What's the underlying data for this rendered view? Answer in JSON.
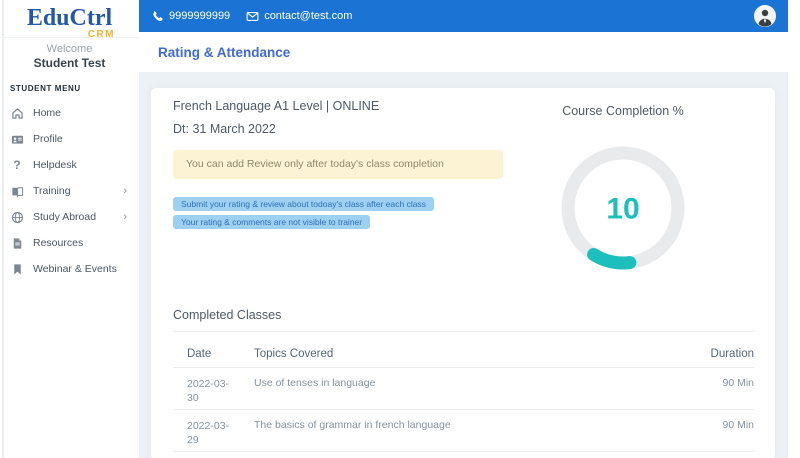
{
  "ui": {
    "chevron": "›",
    "question_glyph": "?"
  },
  "topbar": {
    "phone": "9999999999",
    "email": "contact@test.com"
  },
  "sidebar": {
    "logo": "EduCtrl",
    "logo_sub": "CRM",
    "welcome": "Welcome",
    "user_name": "Student Test",
    "menu_label": "STUDENT MENU",
    "items": [
      {
        "label": "Home",
        "icon": "home-icon",
        "has_submenu": false
      },
      {
        "label": "Profile",
        "icon": "profile-icon",
        "has_submenu": false
      },
      {
        "label": "Helpdesk",
        "icon": "helpdesk-icon",
        "has_submenu": false
      },
      {
        "label": "Training",
        "icon": "training-icon",
        "has_submenu": true
      },
      {
        "label": "Study Abroad",
        "icon": "globe-icon",
        "has_submenu": true
      },
      {
        "label": "Resources",
        "icon": "resources-icon",
        "has_submenu": false
      },
      {
        "label": "Webinar & Events",
        "icon": "webinar-icon",
        "has_submenu": false
      }
    ]
  },
  "page": {
    "title": "Rating & Attendance"
  },
  "course": {
    "name": "French Language A1 Level | ONLINE",
    "date_label": "Dt: 31 March 2022",
    "alert": "You can add Review only after today's class completion",
    "badges": [
      "Submit your rating & review about todoay's class after each class",
      "Your rating & comments are not visible to trainer"
    ]
  },
  "completion": {
    "title": "Course Completion %",
    "percent": "10",
    "gauge": {
      "type": "donut",
      "value": 10,
      "max": 100,
      "track_color": "#e9eaeb",
      "arc_color": "#1dbfbc"
    }
  },
  "classes": {
    "title": "Completed Classes",
    "columns": [
      "Date",
      "Topics Covered",
      "Duration"
    ],
    "rows": [
      {
        "date": "2022-03-30",
        "topic": "Use of tenses in language",
        "duration": "90 Min"
      },
      {
        "date": "2022-03-29",
        "topic": "The basics of grammar in french language",
        "duration": "90 Min"
      }
    ]
  },
  "colors": {
    "topbar_blue": "#1b74d3",
    "title_blue": "#3f6ad8",
    "logo_blue": "#2457aa",
    "logo_gold": "#f0b32c",
    "teal": "#1dbfbc",
    "alert_bg": "#fcf3d4",
    "badge_bg": "#9ed1f1",
    "content_bg": "#ecf1f5"
  }
}
